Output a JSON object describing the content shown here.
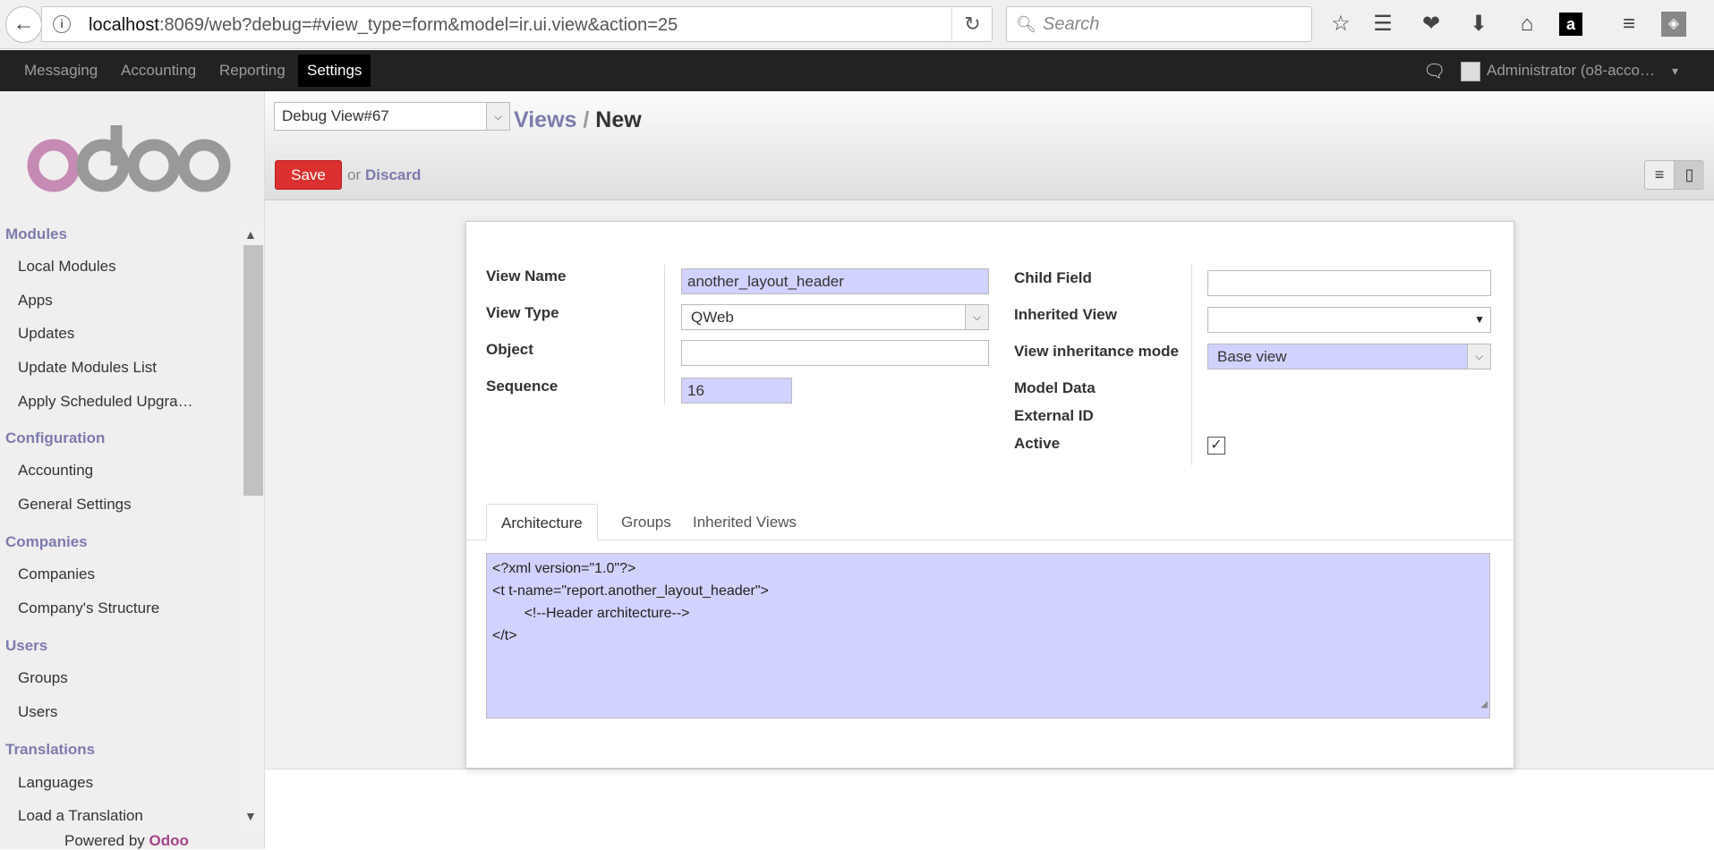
{
  "browser": {
    "url_host": "localhost",
    "url_rest": ":8069/web?debug=#view_type=form&model=ir.ui.view&action=25",
    "search_placeholder": "Search"
  },
  "topnav": {
    "items": [
      "Messaging",
      "Accounting",
      "Reporting",
      "Settings"
    ],
    "active": "Settings",
    "user": "Administrator (o8-acco…"
  },
  "sidebar": {
    "sections": [
      {
        "title": "Modules",
        "items": [
          "Local Modules",
          "Apps",
          "Updates",
          "Update Modules List",
          "Apply Scheduled Upgra…"
        ]
      },
      {
        "title": "Configuration",
        "items": [
          "Accounting",
          "General Settings"
        ]
      },
      {
        "title": "Companies",
        "items": [
          "Companies",
          "Company's Structure"
        ]
      },
      {
        "title": "Users",
        "items": [
          "Groups",
          "Users"
        ]
      },
      {
        "title": "Translations",
        "items": [
          "Languages",
          "Load a Translation"
        ]
      }
    ],
    "powered_prefix": "Powered by ",
    "powered_brand": "Odoo"
  },
  "control": {
    "debug_select": "Debug View#67",
    "breadcrumb_link": "Views",
    "breadcrumb_sep": "/",
    "breadcrumb_current": "New",
    "save_label": "Save",
    "or_label": "or",
    "discard_label": "Discard"
  },
  "form": {
    "view_name_label": "View Name",
    "view_name": "another_layout_header",
    "view_type_label": "View Type",
    "view_type": "QWeb",
    "object_label": "Object",
    "object": "",
    "sequence_label": "Sequence",
    "sequence": "16",
    "child_field_label": "Child Field",
    "child_field": "",
    "inherited_view_label": "Inherited View",
    "inherited_view": "",
    "inheritance_mode_label": "View inheritance mode",
    "inheritance_mode": "Base view",
    "model_data_label": "Model Data",
    "external_id_label": "External ID",
    "active_label": "Active",
    "active": true
  },
  "tabs": [
    "Architecture",
    "Groups",
    "Inherited Views"
  ],
  "active_tab": "Architecture",
  "architecture": "<?xml version=\"1.0\"?>\n<t t-name=\"report.another_layout_header\">\n        <!--Header architecture-->\n</t>",
  "colors": {
    "accent": "#7c7bad",
    "save": "#dc3030",
    "required_bg": "#d2d2ff"
  }
}
